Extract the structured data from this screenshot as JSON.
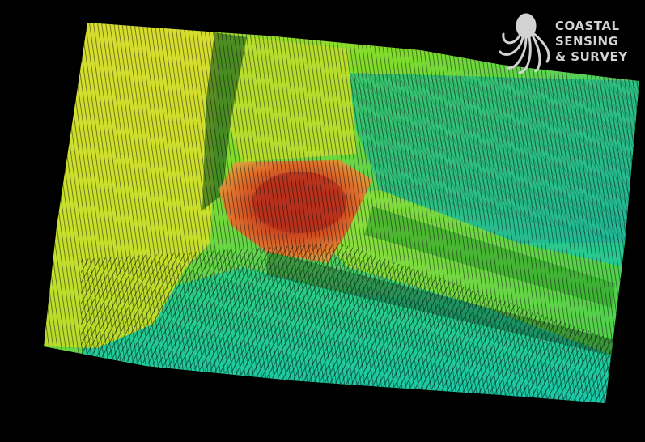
{
  "scene": {
    "background": "#000000",
    "colormap": [
      "#19c9a8",
      "#3bd06a",
      "#7fdc2c",
      "#c8e32a",
      "#e0d03a",
      "#e0752e",
      "#b8341f"
    ]
  },
  "logo": {
    "icon": "octopus-icon",
    "color": "#d2d2d2",
    "line_1": "COASTAL",
    "line_2": "SENSING",
    "line_3": "& SURVEY"
  }
}
